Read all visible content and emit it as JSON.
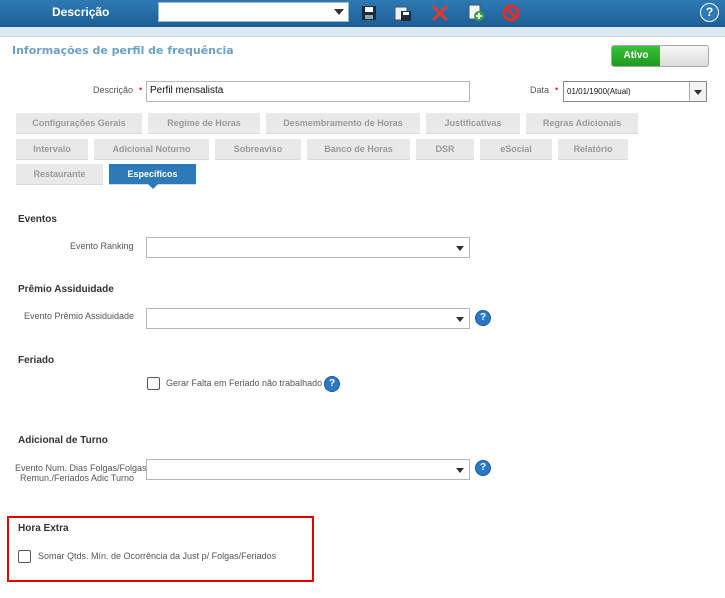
{
  "header": {
    "title": "Descrição",
    "combo_value": "",
    "icons": [
      "save-icon",
      "save-as-icon",
      "delete-icon",
      "copy-icon",
      "cancel-icon"
    ],
    "help": "?"
  },
  "form": {
    "section_title": "Informações de perfil de frequência",
    "status_toggle": "Ativo",
    "descricao_label": "Descrição",
    "descricao_value": "Perfil mensalista",
    "data_label": "Data",
    "data_value": "01/01/1900(Atual)"
  },
  "tabs": {
    "row1": [
      "Configurações Gerais",
      "Regime de Horas",
      "Desmembramento de Horas",
      "Justificativas",
      "Regras Adicionais"
    ],
    "row2": [
      "Intervalo",
      "Adicional Noturno",
      "Sobreaviso",
      "Banco de Horas",
      "DSR",
      "eSocial",
      "Relatório"
    ],
    "row3": [
      "Restaurante",
      "Específicos"
    ],
    "active": "Específicos"
  },
  "groups": {
    "eventos": {
      "title": "Eventos",
      "field_label": "Evento Ranking",
      "value": ""
    },
    "premio": {
      "title": "Prêmio Assiduidade",
      "field_label": "Evento Prêmio Assiduidade",
      "value": ""
    },
    "feriado": {
      "title": "Feriado",
      "checkbox_label": "Gerar Falta em Feriado não trabalhado",
      "checked": false
    },
    "turno": {
      "title": "Adicional de Turno",
      "field_label_1": "Evento Num. Dias Folgas/Folgas",
      "field_label_2": "Remun./Feriados Adic Turno",
      "value": ""
    },
    "hora_extra": {
      "title": "Hora Extra",
      "checkbox_label": "Somar Qtds. Mín. de Ocorrência da Just p/ Folgas/Feriados",
      "checked": false
    }
  },
  "colors": {
    "header_blue": "#1d5f95",
    "active_tab": "#2c7ab7",
    "toggle_green": "#1e9a20",
    "highlight_red": "#e00000"
  }
}
